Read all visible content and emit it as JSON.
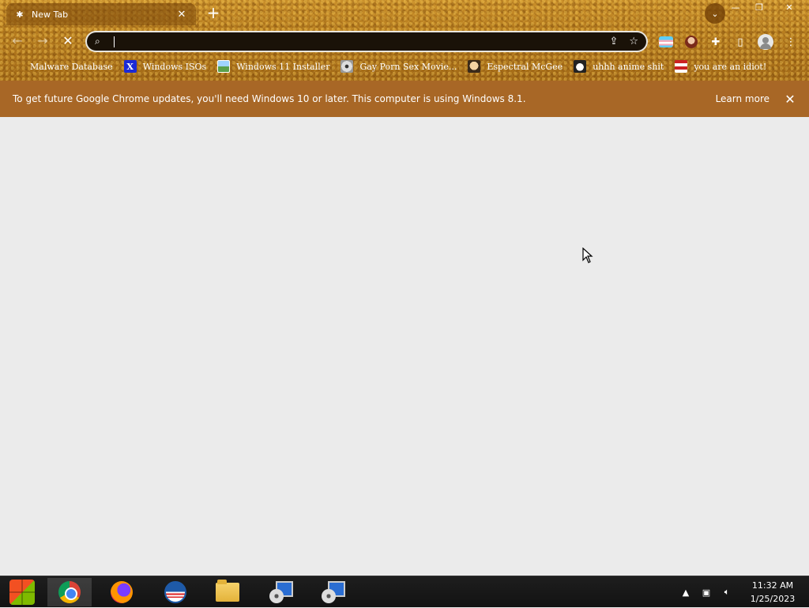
{
  "tab": {
    "title": "New Tab",
    "favicon": "loading-spinner-icon"
  },
  "window_controls": [
    "minimize",
    "restore",
    "close"
  ],
  "toolbar": {
    "back": "back-arrow-icon",
    "forward": "forward-arrow-icon",
    "stop": "stop-icon",
    "omnibox_value": ""
  },
  "bookmarks": [
    {
      "label": "Malware Database",
      "icon": "malware-icon"
    },
    {
      "label": "Windows ISOs",
      "icon": "x-icon"
    },
    {
      "label": "Windows 11 Installer",
      "icon": "image-icon"
    },
    {
      "label": "Gay Porn Sex Movie...",
      "icon": "disc-icon"
    },
    {
      "label": "Espectral McGee",
      "icon": "face-icon"
    },
    {
      "label": "uhhh anime shit",
      "icon": "anime-icon"
    },
    {
      "label": "you are an idiot!",
      "icon": "flag-icon"
    }
  ],
  "infobar": {
    "message": "To get future Google Chrome updates, you'll need Windows 10 or later. This computer is using Windows 8.1.",
    "learn_more": "Learn more"
  },
  "taskbar": {
    "apps": [
      "start",
      "chrome",
      "firefox",
      "obama",
      "file-explorer",
      "setup",
      "setup"
    ],
    "clock_time": "11:32 AM",
    "clock_date": "1/25/2023"
  },
  "colors": {
    "frame": "#b77d1f",
    "infobar": "#a86726",
    "page": "#ebebeb",
    "taskbar": "#161616"
  }
}
